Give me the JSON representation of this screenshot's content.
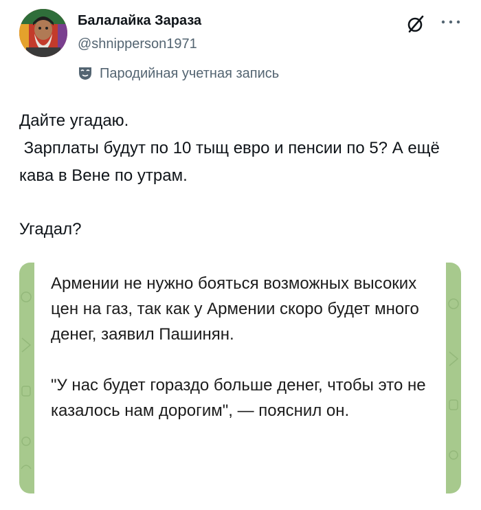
{
  "author": {
    "display_name": "Балалайка Зараза",
    "handle": "@shnipperson1971",
    "parody_label": "Пародийная учетная запись"
  },
  "icons": {
    "avatar": "avatar-image",
    "grok": "grok-icon",
    "more": "more-horizontal-icon",
    "parody": "theater-mask-icon"
  },
  "tweet": {
    "line1": "Дайте угадаю.",
    "line2": " Зарплаты будут по 10 тыщ евро и пенсии по 5? А ещё кава в Вене по утрам.",
    "line3": "Угадал?"
  },
  "media": {
    "paragraph1": "Армении не нужно бояться возможных высоких цен на газ, так как у Армении скоро будет много денег, заявил Пашинян.",
    "paragraph2": "\"У нас будет гораздо больше денег, чтобы это не казалось нам дорогим\", — пояснил он."
  },
  "colors": {
    "text_primary": "#0f1419",
    "text_secondary": "#536471",
    "media_background": "#a7c98d"
  }
}
